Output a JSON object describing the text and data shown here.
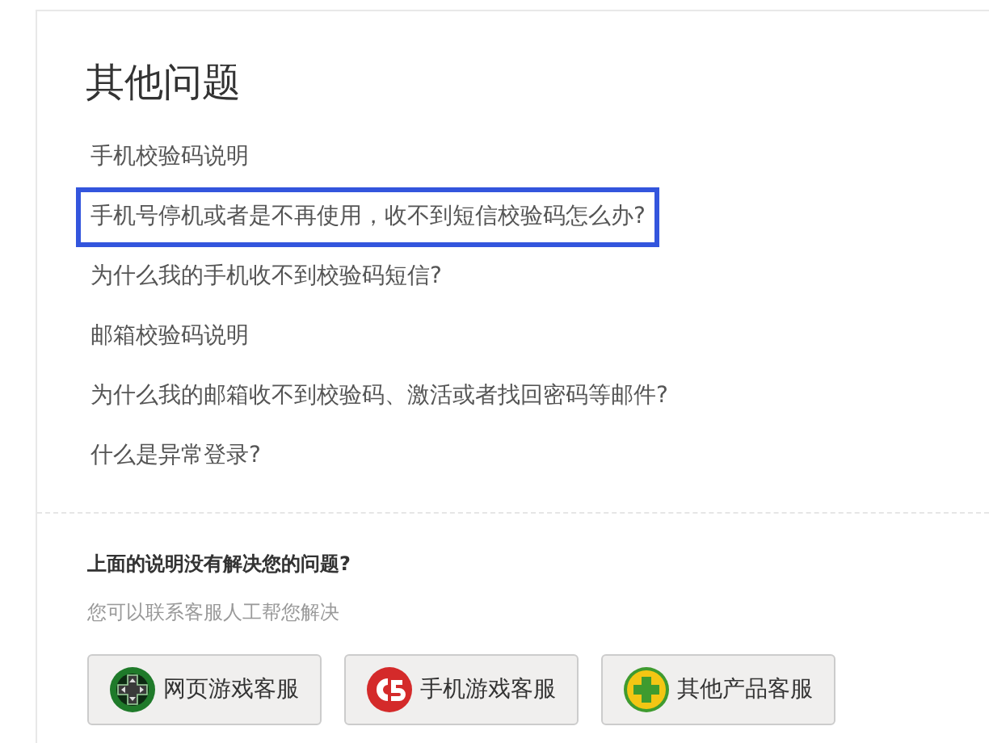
{
  "title": "其他问题",
  "questions": [
    {
      "text": "手机校验码说明",
      "selected": false
    },
    {
      "text": "手机号停机或者是不再使用，收不到短信校验码怎么办?",
      "selected": true
    },
    {
      "text": "为什么我的手机收不到校验码短信?",
      "selected": false
    },
    {
      "text": "邮箱校验码说明",
      "selected": false
    },
    {
      "text": "为什么我的邮箱收不到校验码、激活或者找回密码等邮件?",
      "selected": false
    },
    {
      "text": "什么是异常登录?",
      "selected": false
    }
  ],
  "help": {
    "heading": "上面的说明没有解决您的问题?",
    "subtext": "您可以联系客服人工帮您解决"
  },
  "buttons": [
    {
      "kind": "web",
      "label": "网页游戏客服"
    },
    {
      "kind": "mobile",
      "label": "手机游戏客服"
    },
    {
      "kind": "other",
      "label": "其他产品客服"
    }
  ]
}
